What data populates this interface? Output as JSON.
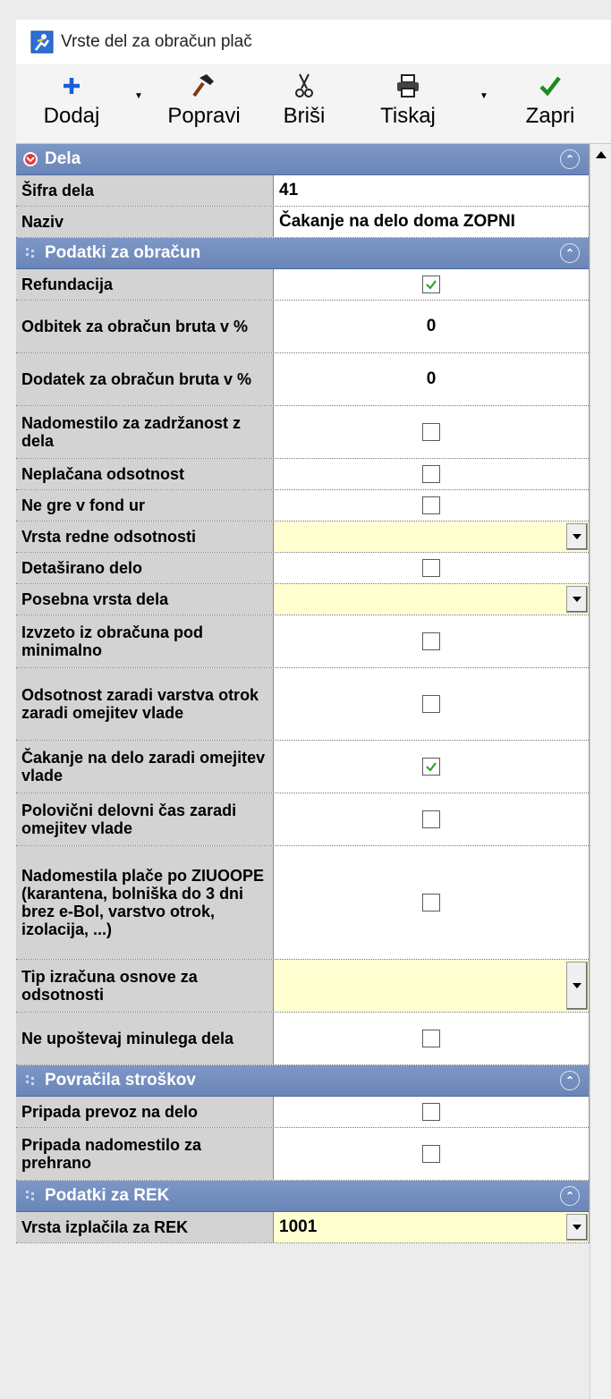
{
  "window": {
    "title": "Vrste del za obračun plač"
  },
  "toolbar": {
    "add": "Dodaj",
    "edit": "Popravi",
    "delete": "Briši",
    "print": "Tiskaj",
    "close": "Zapri"
  },
  "categories": {
    "dela": "Dela",
    "obracun": "Podatki za obračun",
    "povracila": "Povračila stroškov",
    "rek": "Podatki za REK"
  },
  "rows": {
    "sifra": {
      "label": "Šifra dela",
      "value": "41"
    },
    "naziv": {
      "label": "Naziv",
      "value": "Čakanje na delo doma ZOPNI"
    },
    "refundacija": {
      "label": "Refundacija",
      "checked": true
    },
    "odbitek": {
      "label": "Odbitek za obračun bruta v %",
      "value": "0"
    },
    "dodatek": {
      "label": "Dodatek za obračun bruta v %",
      "value": "0"
    },
    "nadomestilo_zadrzanost": {
      "label": "Nadomestilo za zadržanost z dela",
      "checked": false
    },
    "neplacana": {
      "label": "Neplačana odsotnost",
      "checked": false
    },
    "ne_gre_fond": {
      "label": "Ne gre v fond ur",
      "checked": false
    },
    "vrsta_redne": {
      "label": "Vrsta redne odsotnosti",
      "value": ""
    },
    "detasirano": {
      "label": "Detaširano delo",
      "checked": false
    },
    "posebna_vrsta": {
      "label": "Posebna vrsta dela",
      "value": ""
    },
    "izvzeto": {
      "label": "Izvzeto iz obračuna pod minimalno",
      "checked": false
    },
    "odsotnost_varstva": {
      "label": "Odsotnost zaradi varstva otrok zaradi omejitev vlade",
      "checked": false
    },
    "cakanje": {
      "label": "Čakanje na delo zaradi omejitev vlade",
      "checked": true
    },
    "polovicni": {
      "label": "Polovični delovni čas zaradi omejitev vlade",
      "checked": false
    },
    "nadomestila_ziuoope": {
      "label": "Nadomestila plače po ZIUOOPE (karantena, bolniška do 3 dni brez e-Bol, varstvo otrok, izolacija, ...)",
      "checked": false
    },
    "tip_izracuna": {
      "label": "Tip izračuna osnove za odsotnosti",
      "value": ""
    },
    "minulo_delo": {
      "label": "Ne upoštevaj minulega dela",
      "checked": false
    },
    "prevoz": {
      "label": "Pripada prevoz na delo",
      "checked": false
    },
    "prehrana": {
      "label": "Pripada nadomestilo za prehrano",
      "checked": false
    },
    "vrsta_rek": {
      "label": "Vrsta izplačila za REK",
      "value": "1001"
    }
  },
  "colors": {
    "category_bg": "#6f8bbd",
    "label_bg": "#d3d3d3",
    "dropdown_bg": "#ffffd2",
    "check_green": "#2aa52a"
  }
}
